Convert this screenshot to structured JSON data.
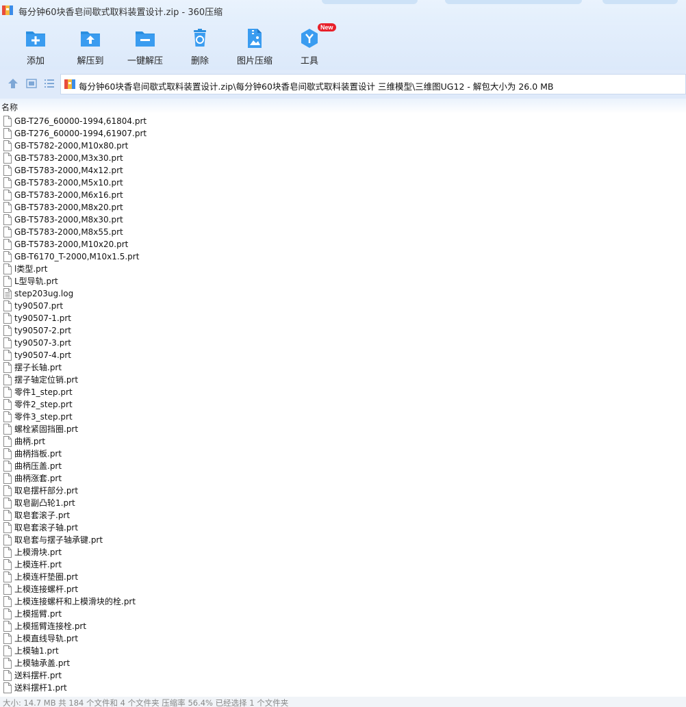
{
  "window": {
    "title": "每分钟60块香皂间歇式取料装置设计.zip - 360压缩"
  },
  "toolbar": {
    "buttons": [
      {
        "label": "添加",
        "icon": "add-icon"
      },
      {
        "label": "解压到",
        "icon": "extract-to-icon"
      },
      {
        "label": "一键解压",
        "icon": "one-click-extract-icon"
      },
      {
        "label": "删除",
        "icon": "delete-icon"
      },
      {
        "label": "图片压缩",
        "icon": "image-compress-icon"
      },
      {
        "label": "工具",
        "icon": "tools-icon",
        "badge": "New"
      }
    ],
    "accent_color": "#2a8fe0",
    "badge_color": "#e8202a"
  },
  "navigation": {
    "up_icon": "up-arrow-icon",
    "view_icons": [
      "thumbnail-view-icon",
      "list-view-icon"
    ]
  },
  "address": {
    "path": "每分钟60块香皂间歇式取料装置设计.zip\\每分钟60块香皂间歇式取料装置设计 三维模型\\三维图UG12 - 解包大小为 26.0 MB"
  },
  "columns": {
    "name": "名称"
  },
  "files": [
    "GB-T276_60000-1994,61804.prt",
    "GB-T276_60000-1994,61907.prt",
    "GB-T5782-2000,M10x80.prt",
    "GB-T5783-2000,M3x30.prt",
    "GB-T5783-2000,M4x12.prt",
    "GB-T5783-2000,M5x10.prt",
    "GB-T5783-2000,M6x16.prt",
    "GB-T5783-2000,M8x20.prt",
    "GB-T5783-2000,M8x30.prt",
    "GB-T5783-2000,M8x55.prt",
    "GB-T5783-2000,M10x20.prt",
    "GB-T6170_T-2000,M10x1.5.prt",
    "l类型.prt",
    "L型导轨.prt",
    "step203ug.log",
    "ty90507.prt",
    "ty90507-1.prt",
    "ty90507-2.prt",
    "ty90507-3.prt",
    "ty90507-4.prt",
    "摆子长轴.prt",
    "摆子轴定位销.prt",
    "零件1_step.prt",
    "零件2_step.prt",
    "零件3_step.prt",
    "螺栓紧固挡圈.prt",
    "曲柄.prt",
    "曲柄挡板.prt",
    "曲柄压盖.prt",
    "曲柄涨套.prt",
    "取皂摆杆部分.prt",
    "取皂副凸轮1.prt",
    "取皂套滚子.prt",
    "取皂套滚子轴.prt",
    "取皂套与摆子轴承键.prt",
    "上模滑块.prt",
    "上模连杆.prt",
    "上模连杆垫圈.prt",
    "上模连接螺杆.prt",
    "上模连接螺杆和上模滑块的栓.prt",
    "上模摇臂.prt",
    "上模摇臂连接栓.prt",
    "上模直线导轨.prt",
    "上模轴1.prt",
    "上模轴承盖.prt",
    "送料摆杆.prt",
    "送料摆杆1.prt"
  ],
  "status": {
    "text": "大小: 14.7 MB 共 184 个文件和 4 个文件夹 压缩率 56.4% 已经选择 1 个文件夹"
  }
}
